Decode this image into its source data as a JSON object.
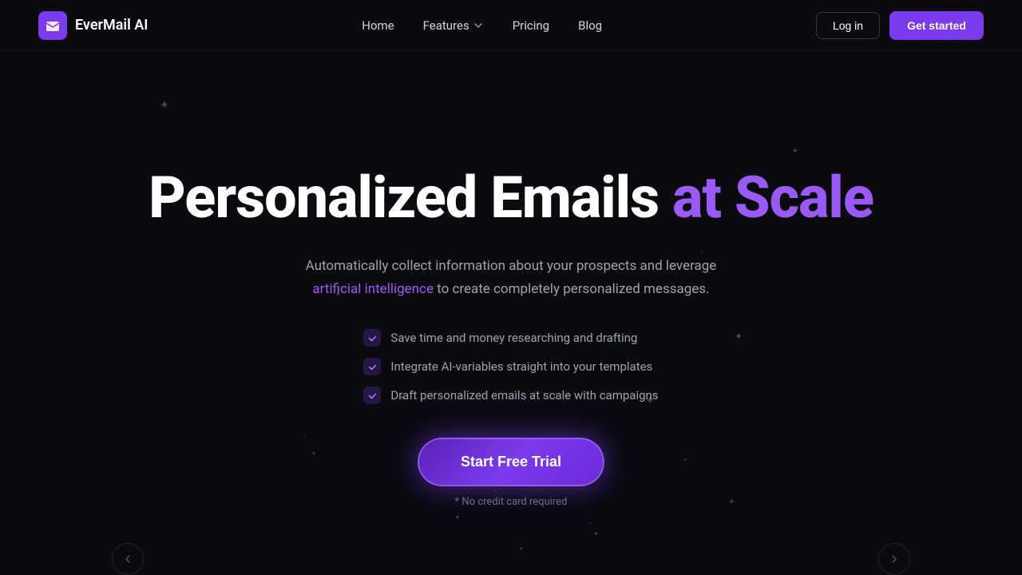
{
  "brand": {
    "name": "EverMail AI",
    "logo_icon": "mail-icon"
  },
  "nav": {
    "links": [
      {
        "label": "Home",
        "href": "#",
        "has_dropdown": false
      },
      {
        "label": "Features",
        "href": "#",
        "has_dropdown": true
      },
      {
        "label": "Pricing",
        "href": "#",
        "has_dropdown": false
      },
      {
        "label": "Blog",
        "href": "#",
        "has_dropdown": false
      }
    ],
    "login_label": "Log in",
    "get_started_label": "Get started"
  },
  "hero": {
    "title_white": "Personalized Emails",
    "title_purple": "at Scale",
    "subtitle_before": "Automatically collect information about your prospects and leverage",
    "subtitle_ai_link": "artificial intelligence",
    "subtitle_after": "to create completely personalized messages.",
    "checklist": [
      "Save time and money researching and drafting",
      "Integrate AI-variables straight into your templates",
      "Draft personalized emails at scale with campaigns"
    ],
    "cta_button": "Start Free Trial",
    "no_credit": "* No credit card required"
  }
}
